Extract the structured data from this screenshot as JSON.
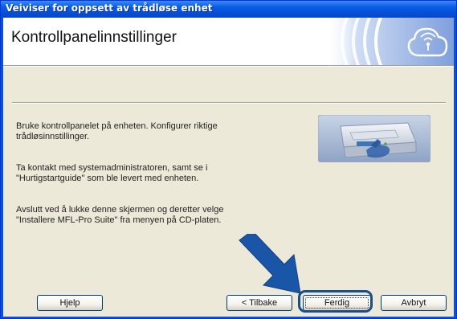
{
  "window": {
    "title": "Veiviser for oppsett av trådløse enhet"
  },
  "header": {
    "title": "Kontrollpanelinnstillinger",
    "logo_icon": "wireless-logo-icon"
  },
  "content": {
    "paragraphs": [
      "Bruke kontrollpanelet på enheten. Konfigurer riktige\ntrådløsinnstillinger.",
      "Ta kontakt med systemadministratoren, samt se i\n\"Hurtigstartguide\" som ble levert med enheten.",
      "Avslutt ved å lukke denne skjermen og deretter velge\n\"Installere MFL-Pro Suite\" fra menyen på CD-platen."
    ],
    "device_icon": "printer-control-panel-icon"
  },
  "buttons": {
    "help": "Hjelp",
    "back": "< Tilbake",
    "finish": "Ferdig",
    "cancel": "Avbryt"
  },
  "colors": {
    "titlebar": "#0a5ee6",
    "dialog_bg": "#ece9d8",
    "highlight": "#1a4d8c",
    "arrow": "#1a56a8"
  }
}
